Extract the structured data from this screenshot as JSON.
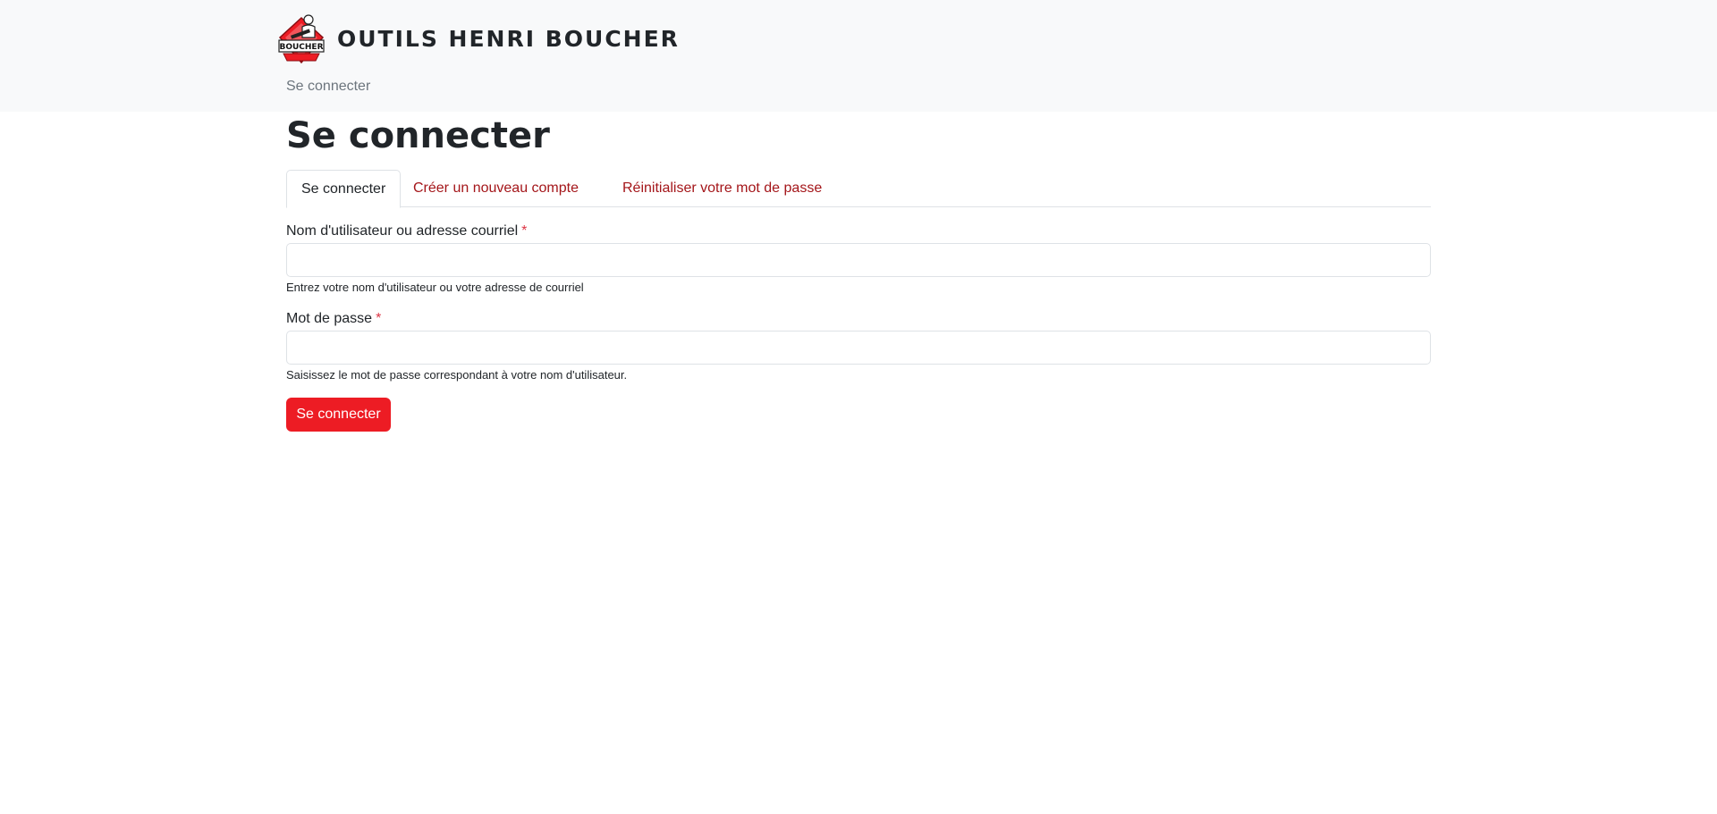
{
  "header": {
    "logo_text": "BOUCHER",
    "site_name": "OUTILS HENRI BOUCHER",
    "breadcrumb": "Se connecter"
  },
  "main": {
    "title": "Se connecter",
    "tabs": [
      {
        "label": "Se connecter",
        "active": true
      },
      {
        "label": "Créer un nouveau compte",
        "active": false
      },
      {
        "label": "Réinitialiser votre mot de passe",
        "active": false
      }
    ],
    "form": {
      "username": {
        "label": "Nom d'utilisateur ou adresse courriel",
        "required_marker": "*",
        "value": "",
        "help": "Entrez votre nom d'utilisateur ou votre adresse de courriel"
      },
      "password": {
        "label": "Mot de passe",
        "required_marker": "*",
        "value": "",
        "help": "Saisissez le mot de passe correspondant à votre nom d'utilisateur."
      },
      "submit_label": "Se connecter"
    }
  },
  "colors": {
    "brand_red": "#ed1c24",
    "link_red": "#a4161a",
    "header_bg": "#f8f9fa"
  }
}
